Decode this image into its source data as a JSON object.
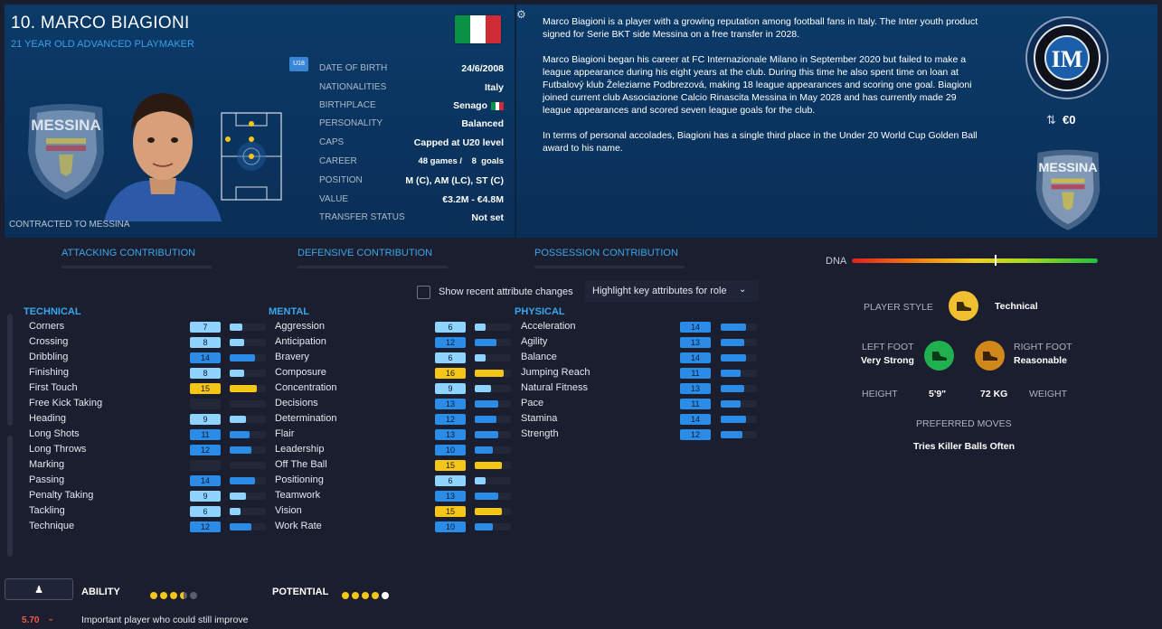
{
  "player": {
    "name": "10. MARCO BIAGIONI",
    "subtitle": "21 YEAR OLD  ADVANCED PLAYMAKER",
    "contract": "CONTRACTED TO MESSINA",
    "age_tag": "U18",
    "club_badge_text": "MESSINA",
    "flag_colors": [
      "#0a9246",
      "#ffffff",
      "#ce2b37"
    ]
  },
  "info": [
    {
      "k": "DATE OF BIRTH",
      "v": "24/6/2008"
    },
    {
      "k": "NATIONALITIES",
      "v": "Italy"
    },
    {
      "k": "BIRTHPLACE",
      "v": "Senago"
    },
    {
      "k": "PERSONALITY",
      "v": "Balanced"
    },
    {
      "k": "CAPS",
      "v": "Capped at U20 level"
    },
    {
      "k": "CAREER",
      "v": "48 games /    8  goals"
    },
    {
      "k": "POSITION",
      "v": "M (C), AM (LC), ST (C)"
    },
    {
      "k": "VALUE",
      "v": "€3.2M - €4.8M"
    },
    {
      "k": "TRANSFER STATUS",
      "v": "Not set"
    }
  ],
  "bio": [
    "Marco Biagioni is a player with a growing reputation among football fans in Italy. The Inter youth product signed for Serie BKT side Messina on a free transfer in 2028.",
    "Marco Biagioni began his career at FC Internazionale Milano in September 2020 but failed to make a league appearance during his eight years at the club. During this time he also spent time on loan at Futbalový klub Železiarne Podbrezová, making 18 league appearances and scoring one goal. Biagioni joined current club Associazione Calcio Rinascita Messina in May 2028 and has currently made 29 league appearances and scored seven league goals for the club.",
    "In terms of personal accolades, Biagioni has a single third place in the Under 20 World Cup Golden Ball award to his name."
  ],
  "transfer_value": "€0",
  "tabs": [
    "ATTACKING CONTRIBUTION",
    "DEFENSIVE CONTRIBUTION",
    "POSSESSION CONTRIBUTION"
  ],
  "controls": {
    "show_changes": "Show recent attribute changes",
    "highlight": "Highlight key attributes for role"
  },
  "dna_label": "DNA",
  "dna_level": 0.58,
  "attributes": {
    "technical": {
      "title": "TECHNICAL",
      "items": [
        {
          "name": "Corners",
          "value": "7"
        },
        {
          "name": "Crossing",
          "value": "8"
        },
        {
          "name": "Dribbling",
          "value": "14"
        },
        {
          "name": "Finishing",
          "value": "8"
        },
        {
          "name": "First Touch",
          "value": "15"
        },
        {
          "name": "Free Kick Taking",
          "value": ""
        },
        {
          "name": "Heading",
          "value": "9"
        },
        {
          "name": "Long Shots",
          "value": "11"
        },
        {
          "name": "Long Throws",
          "value": "12"
        },
        {
          "name": "Marking",
          "value": ""
        },
        {
          "name": "Passing",
          "value": "14"
        },
        {
          "name": "Penalty Taking",
          "value": "9"
        },
        {
          "name": "Tackling",
          "value": "6"
        },
        {
          "name": "Technique",
          "value": "12"
        }
      ]
    },
    "mental": {
      "title": "MENTAL",
      "items": [
        {
          "name": "Aggression",
          "value": "6"
        },
        {
          "name": "Anticipation",
          "value": "12"
        },
        {
          "name": "Bravery",
          "value": "6"
        },
        {
          "name": "Composure",
          "value": "16"
        },
        {
          "name": "Concentration",
          "value": "9"
        },
        {
          "name": "Decisions",
          "value": "13"
        },
        {
          "name": "Determination",
          "value": "12"
        },
        {
          "name": "Flair",
          "value": "13"
        },
        {
          "name": "Leadership",
          "value": "10"
        },
        {
          "name": "Off The Ball",
          "value": "15"
        },
        {
          "name": "Positioning",
          "value": "6"
        },
        {
          "name": "Teamwork",
          "value": "13"
        },
        {
          "name": "Vision",
          "value": "15"
        },
        {
          "name": "Work Rate",
          "value": "10"
        }
      ]
    },
    "physical": {
      "title": "PHYSICAL",
      "items": [
        {
          "name": "Acceleration",
          "value": "14"
        },
        {
          "name": "Agility",
          "value": "13"
        },
        {
          "name": "Balance",
          "value": "14"
        },
        {
          "name": "Jumping Reach",
          "value": "11"
        },
        {
          "name": "Natural Fitness",
          "value": "13"
        },
        {
          "name": "Pace",
          "value": "11"
        },
        {
          "name": "Stamina",
          "value": "14"
        },
        {
          "name": "Strength",
          "value": "12"
        }
      ]
    }
  },
  "style": {
    "player_style_label": "PLAYER STYLE",
    "player_style_value": "Technical",
    "left_foot_label": "LEFT FOOT",
    "left_foot_value": "Very Strong",
    "right_foot_label": "RIGHT FOOT",
    "right_foot_value": "Reasonable",
    "height_label": "HEIGHT",
    "height_value": "5'9\"",
    "weight_value": "72 KG",
    "weight_label": "WEIGHT",
    "preferred_moves_label": "PREFERRED MOVES",
    "preferred_moves_value": "Tries Killer Balls Often"
  },
  "footer": {
    "ability_label": "ABILITY",
    "potential_label": "POTENTIAL",
    "ability_stars": 3.5,
    "potential_stars": 5,
    "rating": "5.70",
    "comment": "Important player who could still improve"
  },
  "colors": {
    "accent": "#39a6ef",
    "yellow": "#f5c518",
    "light_blue": "#8fd3ff",
    "mid_blue": "#2a8ce6"
  }
}
